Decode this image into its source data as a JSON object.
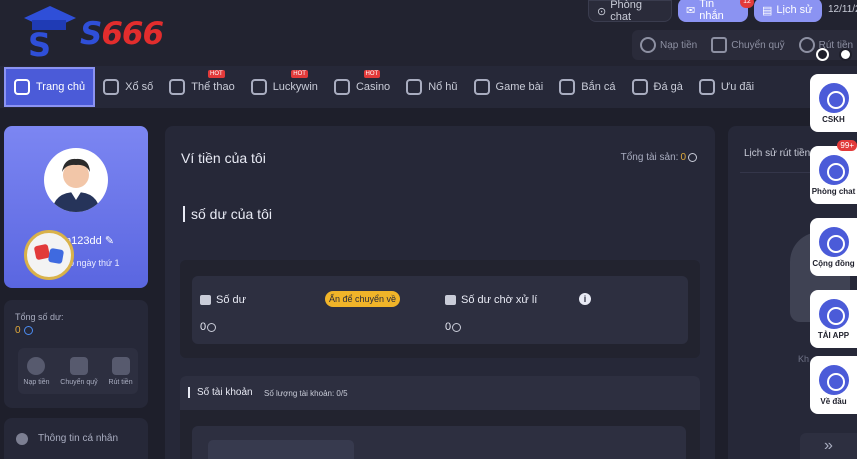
{
  "brand": {
    "logo_prefix": "S",
    "logo_main": "S666"
  },
  "top": {
    "chat_label": "Phòng chat",
    "messages_label": "Tin nhắn",
    "messages_badge": "12",
    "history_label": "Lịch sử",
    "date_text": "12/11/2"
  },
  "quick_actions": [
    {
      "label": "Nạp tiền",
      "icon": "deposit-icon"
    },
    {
      "label": "Chuyển quỹ",
      "icon": "transfer-icon"
    },
    {
      "label": "Rút tiền",
      "icon": "withdraw-icon"
    }
  ],
  "nav": [
    {
      "label": "Trang chủ",
      "icon": "home-icon",
      "active": true
    },
    {
      "label": "Xổ số",
      "icon": "lottery-icon"
    },
    {
      "label": "Thể thao",
      "icon": "sports-icon",
      "hot": "HOT"
    },
    {
      "label": "Luckywin",
      "icon": "luckywin-icon",
      "hot": "HOT"
    },
    {
      "label": "Casino",
      "icon": "casino-icon",
      "hot": "HOT"
    },
    {
      "label": "Nổ hũ",
      "icon": "slot-icon"
    },
    {
      "label": "Game bài",
      "icon": "cards-icon"
    },
    {
      "label": "Bắn cá",
      "icon": "fish-icon"
    },
    {
      "label": "Đá gà",
      "icon": "rooster-icon"
    },
    {
      "label": "Ưu đãi",
      "icon": "gift-icon"
    }
  ],
  "profile": {
    "username": "m123dd",
    "login_days": "ập ngày thứ 1"
  },
  "balance": {
    "label": "Tổng số dư:",
    "value": "0",
    "actions": [
      {
        "label": "Nạp tiền",
        "icon": "deposit-icon"
      },
      {
        "label": "Chuyển quỹ",
        "icon": "transfer-icon"
      },
      {
        "label": "Rút tiền",
        "icon": "withdraw-icon"
      }
    ],
    "personal_info": "Thông tin cá nhân"
  },
  "wallet": {
    "title": "Ví tiền của tôi",
    "total_assets_label": "Tổng tài sản:",
    "total_assets_value": "0",
    "section_title": "số dư của tôi",
    "balance_label": "Số dư",
    "balance_value": "0",
    "transfer_pill": "Ấn để chuyển về",
    "pending_label": "Số dư chờ xử lí",
    "pending_value": "0",
    "info_icon": "i",
    "accounts_title": "Số tài khoản",
    "accounts_count": "Số lượng tài khoản:  0/5"
  },
  "right_panel": {
    "title": "Lịch sử rút tiền",
    "empty_text": "Kh"
  },
  "float_menu": [
    {
      "label": "CSKH",
      "icon": "support-icon"
    },
    {
      "label": "Phòng chat",
      "icon": "chat-icon",
      "badge": "99+"
    },
    {
      "label": "Cộng đồng",
      "icon": "telegram-icon"
    },
    {
      "label": "TẢI APP",
      "icon": "app-icon"
    },
    {
      "label": "Về đầu",
      "icon": "arrow-up-icon"
    }
  ],
  "colors": {
    "accent": "#4b5bd8",
    "gold": "#f0b429",
    "hot": "#e23a3a"
  }
}
